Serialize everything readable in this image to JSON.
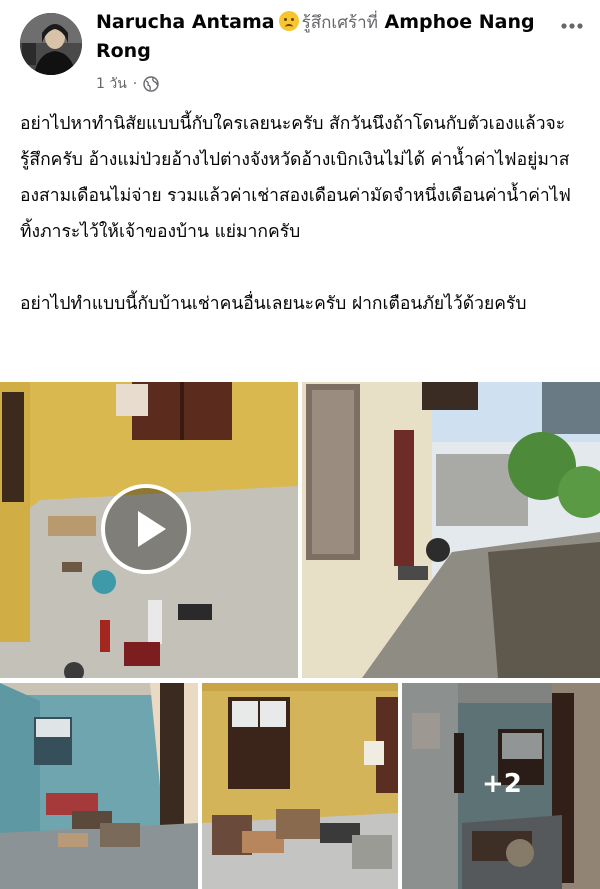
{
  "post": {
    "author": "Narucha Antama",
    "feeling_icon": "sad-face-emoji",
    "feeling_text": "รู้สึกเศร้าที่",
    "location": "Amphoe Nang Rong",
    "time": "1 วัน",
    "privacy_icon": "globe-icon",
    "more_icon": "more-options-icon",
    "paragraph_1": "อย่าไปหาทำนิสัยแบบนี้กับใครเลยนะครับ สักวันนึงถ้าโดนกับตัวเองแล้วจะรู้สึกครับ อ้างแม่ป่วยอ้างไปต่างจังหวัดอ้างเบิกเงินไม่ได้  ค่าน้ำค่าไฟอยู่มาสองสามเดือนไม่จ่าย รวมแล้วค่าเช่าสองเดือนค่ามัดจำหนึ่งเดือนค่าน้ำค่าไฟ ทิ้งภาระไว้ให้เจ้าของบ้าน แย่มากครับ",
    "paragraph_2": "อย่าไปทำแบบนี้กับบ้านเช่าคนอื่นเลยนะครับ ฝากเตือนภัยไว้ด้วยครับ"
  },
  "media": {
    "play_icon": "play-icon",
    "extra_count": "+2"
  },
  "colors": {
    "text": "#050505",
    "secondary": "#65676b",
    "emoji": "#f7c52e"
  }
}
